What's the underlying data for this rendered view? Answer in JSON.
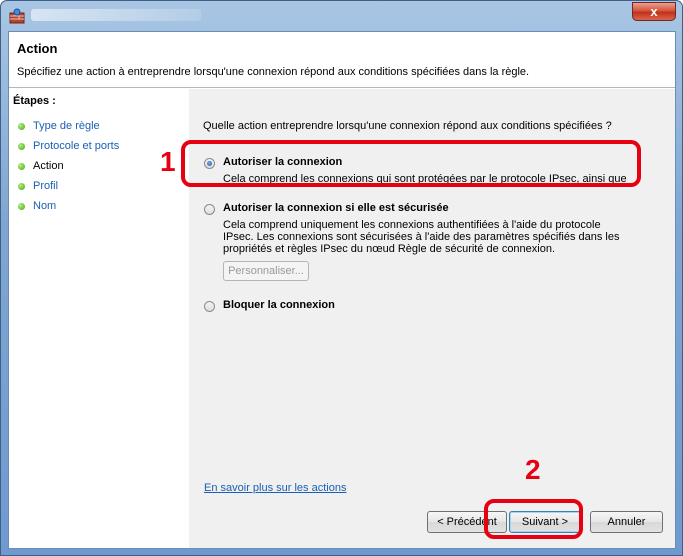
{
  "header": {
    "title": "Action",
    "subtitle": "Spécifiez une action à entreprendre lorsqu'une connexion répond aux conditions spécifiées dans la règle."
  },
  "steps": {
    "title": "Étapes :",
    "items": [
      {
        "label": "Type de règle"
      },
      {
        "label": "Protocole et ports"
      },
      {
        "label": "Action"
      },
      {
        "label": "Profil"
      },
      {
        "label": "Nom"
      }
    ]
  },
  "content": {
    "question": "Quelle action entreprendre lorsqu'une connexion répond aux conditions spécifiées ?",
    "options": [
      {
        "label": "Autoriser la connexion",
        "description": "Cela comprend les connexions qui sont protégées par le protocole IPsec, ainsi que celles qui ne le sont pas.",
        "selected": true
      },
      {
        "label": "Autoriser la connexion si elle est sécurisée",
        "description": "Cela comprend uniquement les connexions authentifiées à l'aide du protocole IPsec. Les connexions sont sécurisées à l'aide des paramètres spécifiés dans les propriétés et règles IPsec du nœud Règle de sécurité de connexion.",
        "selected": false
      },
      {
        "label": "Bloquer la connexion",
        "selected": false
      }
    ],
    "customize_label": "Personnaliser...",
    "learn_more": "En savoir plus sur les actions"
  },
  "buttons": {
    "back": "< Précédent",
    "next": "Suivant >",
    "cancel": "Annuler"
  },
  "callouts": {
    "one": "1",
    "two": "2"
  },
  "titlebar": {
    "close_glyph": "x"
  },
  "colors": {
    "highlight": "#e60012",
    "link": "#1a5fb4"
  }
}
